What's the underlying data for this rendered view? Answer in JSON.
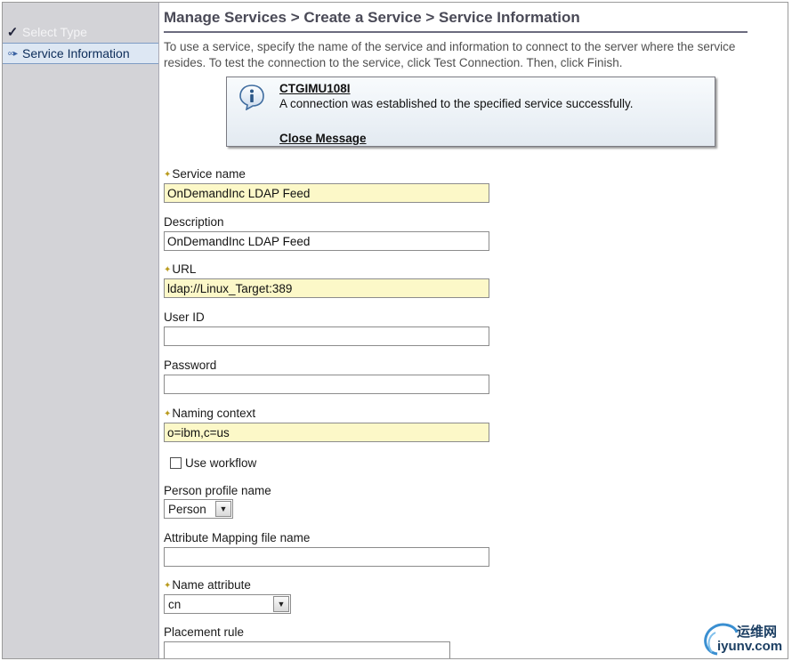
{
  "sidebar": {
    "steps": [
      {
        "label": "Select Type",
        "state": "completed",
        "icon": "check-icon"
      },
      {
        "label": "Service Information",
        "state": "current",
        "icon": "current-step-arrow-icon"
      }
    ]
  },
  "header": {
    "title": "Manage Services > Create a Service > Service Information"
  },
  "intro_text": "To use a service, specify the name of the service and information to connect to the server where the service resides. To test the connection to the service, click Test Connection. Then, click Finish.",
  "message": {
    "icon": "info-icon",
    "id": "CTGIMU108I",
    "text": "A connection was established to the specified service successfully.",
    "close_label": "Close Message"
  },
  "form": {
    "service_name": {
      "label": "Service name",
      "value": "OnDemandInc LDAP Feed",
      "required": true
    },
    "description": {
      "label": "Description",
      "value": "OnDemandInc LDAP Feed",
      "required": false
    },
    "url": {
      "label": "URL",
      "value": "ldap://Linux_Target:389",
      "required": true
    },
    "user_id": {
      "label": "User ID",
      "value": "",
      "required": false
    },
    "password": {
      "label": "Password",
      "value": "",
      "required": false
    },
    "naming_context": {
      "label": "Naming context",
      "value": "o=ibm,c=us",
      "required": true
    },
    "use_workflow": {
      "label": "Use workflow",
      "checked": false
    },
    "person_profile": {
      "label": "Person profile name",
      "selected": "Person"
    },
    "attribute_mapping": {
      "label": "Attribute Mapping file name",
      "value": ""
    },
    "name_attribute": {
      "label": "Name attribute",
      "selected": "cn",
      "required": true
    },
    "placement_rule": {
      "label": "Placement rule",
      "value": ""
    }
  },
  "watermark": {
    "cn_text": "运维网",
    "url_text": "iyunv.com"
  },
  "colors": {
    "required_field_bg": "#fcf8c8",
    "sidebar_bg": "#d3d3d7",
    "current_step_bg": "#dde7f3",
    "title_color": "#4a4a57",
    "required_star": "#b99a1c"
  }
}
